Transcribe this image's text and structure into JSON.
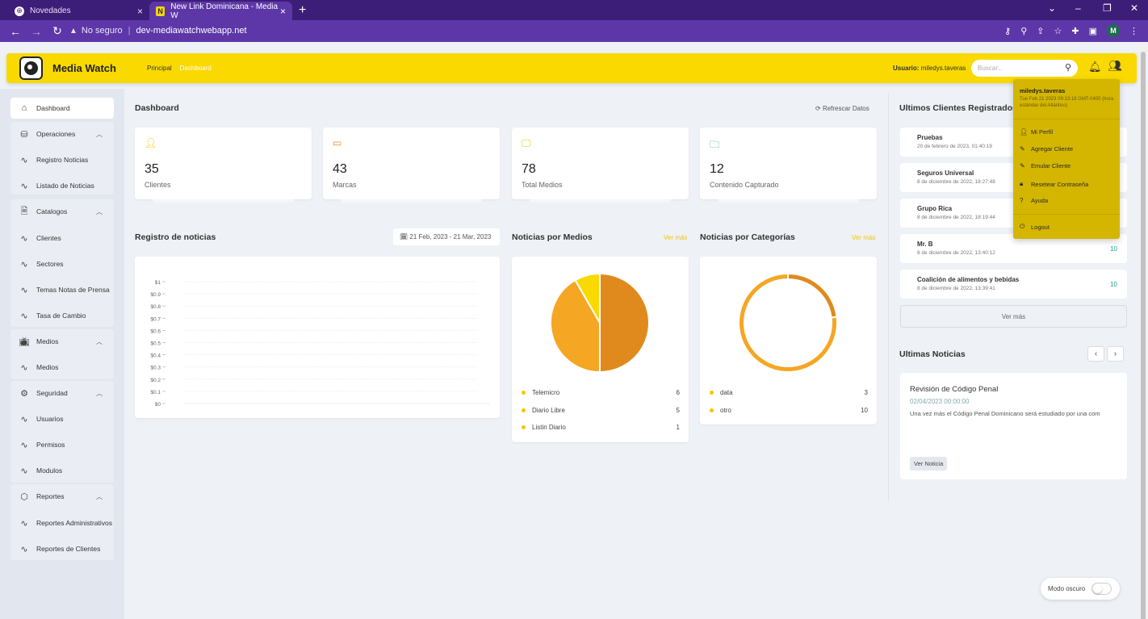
{
  "browser": {
    "tabs": [
      {
        "title": "Novedades",
        "icon": "globe-icon"
      },
      {
        "title": "New Link Dominicana - Media W",
        "icon": "media-watch-favicon"
      }
    ],
    "security_label": "No seguro",
    "url": "dev-mediawatchwebapp.net",
    "profile_initial": "M"
  },
  "header": {
    "brand": "Media Watch",
    "nav": [
      "Principal",
      "Dashboard"
    ],
    "user_prefix": "Usuario:",
    "user_name": "miledys.taveras",
    "search_placeholder": "Buscar..."
  },
  "sidebar": {
    "items": [
      {
        "label": "Dashboard",
        "icon": "home-icon"
      },
      {
        "label": "Operaciones",
        "icon": "database-icon"
      },
      {
        "label": "Registro Noticias",
        "icon": "activity-icon"
      },
      {
        "label": "Listado de Noticias",
        "icon": "activity-icon"
      },
      {
        "label": "Catalogos",
        "icon": "file-icon"
      },
      {
        "label": "Clientes",
        "icon": "activity-icon"
      },
      {
        "label": "Sectores",
        "icon": "activity-icon"
      },
      {
        "label": "Temas Notas de Prensa",
        "icon": "activity-icon"
      },
      {
        "label": "Tasa de Cambio",
        "icon": "activity-icon"
      },
      {
        "label": "Medios",
        "icon": "tv-icon"
      },
      {
        "label": "Medios",
        "icon": "activity-icon"
      },
      {
        "label": "Seguridad",
        "icon": "gear-icon"
      },
      {
        "label": "Usuarios",
        "icon": "activity-icon"
      },
      {
        "label": "Permisos",
        "icon": "activity-icon"
      },
      {
        "label": "Modulos",
        "icon": "activity-icon"
      },
      {
        "label": "Reportes",
        "icon": "box-icon"
      },
      {
        "label": "Reportes Administrativos",
        "icon": "activity-icon"
      },
      {
        "label": "Reportes de Clientes",
        "icon": "activity-icon"
      }
    ]
  },
  "main": {
    "title": "Dashboard",
    "refresh": "Refrescar Datos",
    "stats": [
      {
        "value": "35",
        "label": "Clientes",
        "icon": "user-icon",
        "color": "#f5c400"
      },
      {
        "value": "43",
        "label": "Marcas",
        "icon": "card-icon",
        "color": "#f08a24"
      },
      {
        "value": "78",
        "label": "Total Medios",
        "icon": "monitor-icon",
        "color": "#f5c400"
      },
      {
        "value": "12",
        "label": "Contenido Capturado",
        "icon": "folder-icon",
        "color": "#19a28a"
      }
    ],
    "registro_title": "Registro de noticias",
    "date_range": "21 Feb, 2023 - 21 Mar, 2023",
    "medios_title": "Noticias por Medios",
    "categorias_title": "Noticias por Categorías",
    "ver_mas": "Ver más"
  },
  "chart_data": [
    {
      "type": "line",
      "title": "Registro de noticias",
      "ytick_labels": [
        "$1",
        "$0.9",
        "$0.8",
        "$0.7",
        "$0.6",
        "$0.5",
        "$0.4",
        "$0.3",
        "$0.2",
        "$0.1",
        "$0"
      ],
      "ylim": [
        0,
        1
      ],
      "series": []
    },
    {
      "type": "pie",
      "title": "Noticias por Medios",
      "categories": [
        "Telemicro",
        "Diario Libre",
        "Listin Diario"
      ],
      "values": [
        6,
        5,
        1
      ],
      "colors": [
        "#e08a1e",
        "#f5a623",
        "#f9d900"
      ]
    },
    {
      "type": "pie",
      "title": "Noticias por Categorías",
      "categories": [
        "data",
        "otro"
      ],
      "values": [
        3,
        10
      ],
      "colors": [
        "#e08a1e",
        "#f5a623"
      ],
      "donut": true
    }
  ],
  "right": {
    "clients_title": "Ultimos Clientes Registrados",
    "clients": [
      {
        "name": "Pruebas",
        "date": "20 de febrero de 2023, 01:40:19",
        "count": ""
      },
      {
        "name": "Seguros Universal",
        "date": "8 de diciembre de 2022, 18:27:48",
        "count": ""
      },
      {
        "name": "Grupo Rica",
        "date": "8 de diciembre de 2022, 18:19:44",
        "count": ""
      },
      {
        "name": "Mr. B",
        "date": "8 de diciembre de 2022, 13:40:12",
        "count": "10"
      },
      {
        "name": "Coalición de alimentos y bebidas",
        "date": "8 de diciembre de 2022, 13:39:41",
        "count": "10"
      }
    ],
    "ver_mas": "Ver más",
    "news_title": "Ultimas Noticias",
    "news": {
      "title": "Revisión de Código Penal",
      "date": "02/04/2023 00:00:00",
      "body": "Una vez más el Código Penal Dominicano será estudiado por una com",
      "button": "Ver Noticia"
    }
  },
  "dropdown": {
    "user": "miledys.taveras",
    "time": "Tue Feb 21 2023 09:13:18 GMT-0400 (hora estándar del Atlántico)",
    "items": [
      {
        "label": "Mi Perfil",
        "icon": "user-icon"
      },
      {
        "label": "Agregar Cliente",
        "icon": "edit-icon"
      },
      {
        "label": "Emular Cliente",
        "icon": "edit-icon"
      },
      {
        "label": "Resetear Contraseña",
        "icon": "lock-icon"
      },
      {
        "label": "Ayuda",
        "icon": "help-icon"
      },
      {
        "label": "Logout",
        "icon": "logout-icon"
      }
    ]
  },
  "darkmode_label": "Modo oscuro"
}
